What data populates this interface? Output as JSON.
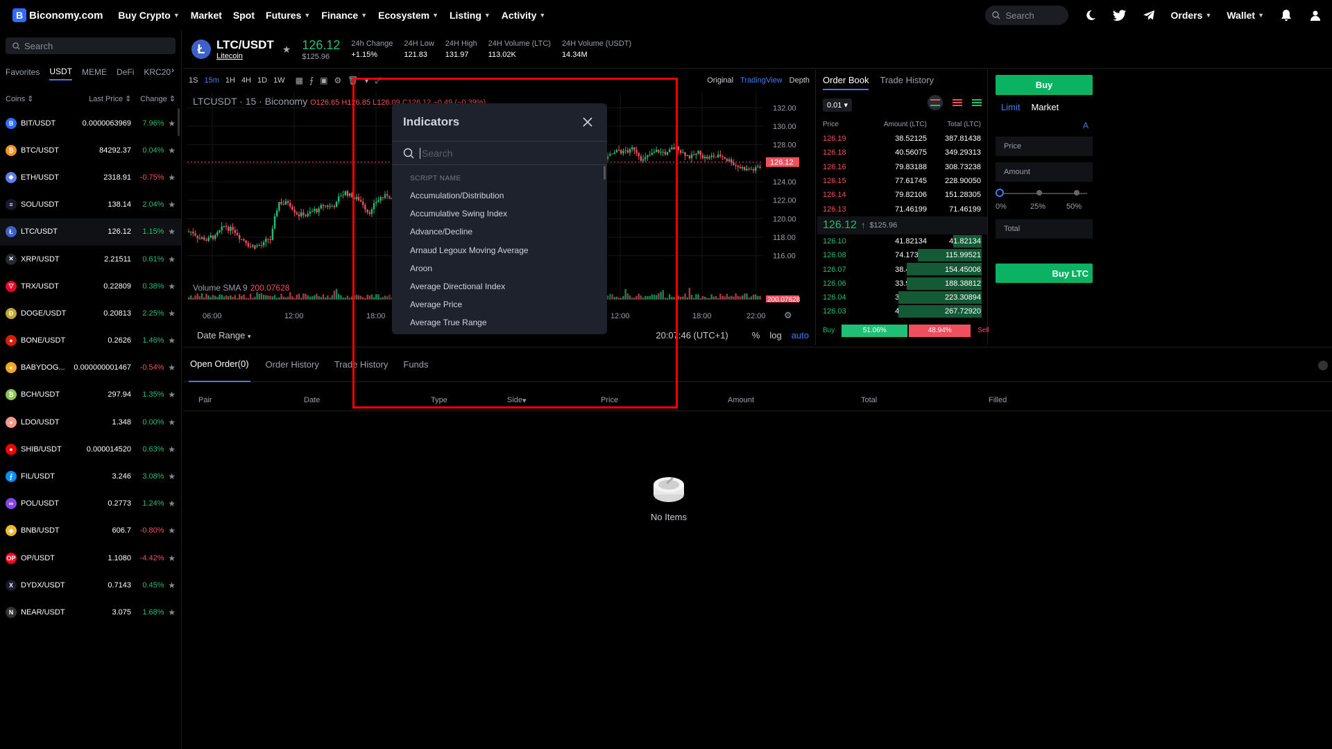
{
  "nav": {
    "logo_letter": "B",
    "logo_text": "Biconomy.com",
    "items": [
      {
        "label": "Buy Crypto",
        "caret": true
      },
      {
        "label": "Market",
        "caret": false
      },
      {
        "label": "Spot",
        "caret": false
      },
      {
        "label": "Futures",
        "caret": true
      },
      {
        "label": "Finance",
        "caret": true
      },
      {
        "label": "Ecosystem",
        "caret": true
      },
      {
        "label": "Listing",
        "caret": true
      },
      {
        "label": "Activity",
        "caret": true
      }
    ],
    "search_placeholder": "Search",
    "orders_label": "Orders",
    "wallet_label": "Wallet"
  },
  "sidebar": {
    "search_placeholder": "Search",
    "tabs": [
      "Favorites",
      "USDT",
      "MEME",
      "DeFi",
      "KRC20"
    ],
    "active_tab": "USDT",
    "headers": {
      "coins": "Coins",
      "price": "Last Price",
      "change": "Change"
    },
    "coins": [
      {
        "pair": "BIT/USDT",
        "price": "0.0000063969",
        "change": "7.96%",
        "dir": "pos",
        "color": "#2f6bff",
        "glyph": "B"
      },
      {
        "pair": "BTC/USDT",
        "price": "84292.37",
        "change": "0.04%",
        "dir": "pos",
        "color": "#f7931a",
        "glyph": "₿"
      },
      {
        "pair": "ETH/USDT",
        "price": "2318.91",
        "change": "-0.75%",
        "dir": "neg",
        "color": "#627eea",
        "glyph": "◆"
      },
      {
        "pair": "SOL/USDT",
        "price": "138.14",
        "change": "2.04%",
        "dir": "pos",
        "color": "#1a1a2e",
        "glyph": "≡"
      },
      {
        "pair": "LTC/USDT",
        "price": "126.12",
        "change": "1.15%",
        "dir": "pos",
        "color": "#3d61c9",
        "glyph": "Ł",
        "active": true
      },
      {
        "pair": "XRP/USDT",
        "price": "2.21511",
        "change": "0.61%",
        "dir": "pos",
        "color": "#23292f",
        "glyph": "✕"
      },
      {
        "pair": "TRX/USDT",
        "price": "0.22809",
        "change": "0.38%",
        "dir": "pos",
        "color": "#eb0029",
        "glyph": "▽"
      },
      {
        "pair": "DOGE/USDT",
        "price": "0.20813",
        "change": "2.25%",
        "dir": "pos",
        "color": "#c2a633",
        "glyph": "Ð"
      },
      {
        "pair": "BONE/USDT",
        "price": "0.2626",
        "change": "1.46%",
        "dir": "pos",
        "color": "#d81e06",
        "glyph": "●"
      },
      {
        "pair": "BABYDOG...",
        "price": "0.000000001467",
        "change": "-0.54%",
        "dir": "neg",
        "color": "#f5a623",
        "glyph": "●"
      },
      {
        "pair": "BCH/USDT",
        "price": "297.94",
        "change": "1.35%",
        "dir": "pos",
        "color": "#8dc351",
        "glyph": "₿"
      },
      {
        "pair": "LDO/USDT",
        "price": "1.348",
        "change": "0.00%",
        "dir": "pos",
        "color": "#f69988",
        "glyph": "●"
      },
      {
        "pair": "SHIB/USDT",
        "price": "0.000014520",
        "change": "0.63%",
        "dir": "pos",
        "color": "#f00500",
        "glyph": "●"
      },
      {
        "pair": "FIL/USDT",
        "price": "3.246",
        "change": "3.08%",
        "dir": "pos",
        "color": "#0090ff",
        "glyph": "⨍"
      },
      {
        "pair": "POL/USDT",
        "price": "0.2773",
        "change": "1.24%",
        "dir": "pos",
        "color": "#8247e5",
        "glyph": "∞"
      },
      {
        "pair": "BNB/USDT",
        "price": "606.7",
        "change": "-0.80%",
        "dir": "neg",
        "color": "#f3ba2f",
        "glyph": "◆"
      },
      {
        "pair": "OP/USDT",
        "price": "1.1080",
        "change": "-4.42%",
        "dir": "neg",
        "color": "#ff0420",
        "glyph": "OP"
      },
      {
        "pair": "DYDX/USDT",
        "price": "0.7143",
        "change": "0.45%",
        "dir": "pos",
        "color": "#1a1a2e",
        "glyph": "X"
      },
      {
        "pair": "NEAR/USDT",
        "price": "3.075",
        "change": "1.68%",
        "dir": "pos",
        "color": "#333",
        "glyph": "N"
      }
    ]
  },
  "ticker": {
    "logo_glyph": "Ł",
    "pair": "LTC/USDT",
    "name": "Litecoin",
    "price": "126.12",
    "sub_price": "$125.96",
    "stats": [
      {
        "label": "24h Change",
        "value": "+1.15%",
        "dir": "pos"
      },
      {
        "label": "24H Low",
        "value": "121.83"
      },
      {
        "label": "24H High",
        "value": "131.97"
      },
      {
        "label": "24H Volume (LTC)",
        "value": "113.02K"
      },
      {
        "label": "24H Volume (USDT)",
        "value": "14.34M"
      }
    ]
  },
  "chart_toolbar": {
    "timeframes": [
      "1S",
      "15m",
      "1H",
      "4H",
      "1D",
      "1W"
    ],
    "active_timeframe": "15m",
    "views": [
      "Original",
      "TradingView",
      "Depth"
    ],
    "active_view": "TradingView"
  },
  "chart": {
    "legend_symbol": "LTCUSDT · 15 · Biconomy",
    "legend_ohlc": "O126.65 H126.85 L126.09 C126.12 −0.49 (−0.39%)",
    "volume_label": "Volume SMA 9",
    "volume_value": "200.07628",
    "bottom_left": "Date Range",
    "time": "20:07:46 (UTC+1)",
    "bottom_right": [
      "%",
      "log",
      "auto"
    ],
    "last_price_tag": "126.12",
    "volume_tag": "200.07628"
  },
  "chart_data": {
    "type": "candlestick",
    "title": "LTCUSDT · 15 · Biconomy",
    "y_ticks": [
      "132.00",
      "130.00",
      "128.00",
      "126.00",
      "124.00",
      "122.00",
      "120.00",
      "118.00",
      "116.00"
    ],
    "x_ticks": [
      "06:00",
      "12:00",
      "18:00",
      "12:00",
      "18:00",
      "22:00"
    ],
    "ylim": [
      115,
      133
    ],
    "last_price": 126.12
  },
  "orderbook": {
    "tabs": [
      "Order Book",
      "Trade History"
    ],
    "active_tab": "Order Book",
    "precision": "0.01",
    "headers": [
      "Price",
      "Amount (LTC)",
      "Total (LTC)"
    ],
    "asks": [
      {
        "price": "126.19",
        "amount": "38.52125",
        "total": "387.81438"
      },
      {
        "price": "126.18",
        "amount": "40.56075",
        "total": "349.29313"
      },
      {
        "price": "126.16",
        "amount": "79.83188",
        "total": "308.73238"
      },
      {
        "price": "126.15",
        "amount": "77.61745",
        "total": "228.90050"
      },
      {
        "price": "126.14",
        "amount": "79.82106",
        "total": "151.28305"
      },
      {
        "price": "126.13",
        "amount": "71.46199",
        "total": "71.46199"
      }
    ],
    "mid_price": "126.12",
    "mid_sub": "$125.96",
    "bids": [
      {
        "price": "126.10",
        "amount": "41.82134",
        "total": "41.82134",
        "depth": 0.18
      },
      {
        "price": "126.08",
        "amount": "74.17388",
        "total": "115.99521",
        "depth": 0.4
      },
      {
        "price": "126.07",
        "amount": "38.45485",
        "total": "154.45006",
        "depth": 0.47
      },
      {
        "price": "126.06",
        "amount": "33.93805",
        "total": "188.38812",
        "depth": 0.47
      },
      {
        "price": "126.04",
        "amount": "34.92083",
        "total": "223.30894",
        "depth": 0.52
      },
      {
        "price": "126.03",
        "amount": "44.42025",
        "total": "267.72920",
        "depth": 0.52
      }
    ],
    "buy_label": "Buy",
    "buy_pct": "51.06%",
    "sell_pct": "48.94%",
    "sell_label": "Sell",
    "buy_ratio": 0.5106
  },
  "tradeform": {
    "buy_tab": "Buy",
    "types": [
      "Limit",
      "Market"
    ],
    "active_type": "Limit",
    "extra": "A",
    "price_placeholder": "Price",
    "amount_placeholder": "Amount",
    "total_placeholder": "Total",
    "pcts": [
      "0%",
      "25%",
      "50%"
    ],
    "submit": "Buy LTC"
  },
  "orders": {
    "tabs": [
      "Open Order(0)",
      "Order History",
      "Trade History",
      "Funds"
    ],
    "active_tab": "Open Order(0)",
    "columns": [
      "Pair",
      "Date",
      "Type",
      "Side",
      "Price",
      "Amount",
      "Total",
      "Filled"
    ],
    "empty_text": "No Items"
  },
  "indicators": {
    "title": "Indicators",
    "search_placeholder": "Search",
    "section_label": "SCRIPT NAME",
    "items": [
      "Accumulation/Distribution",
      "Accumulative Swing Index",
      "Advance/Decline",
      "Arnaud Legoux Moving Average",
      "Aroon",
      "Average Directional Index",
      "Average Price",
      "Average True Range"
    ]
  },
  "colors": {
    "up": "#1fbf75",
    "down": "#f0505d",
    "accent": "#3d7cf5",
    "highlight": "#ff0000"
  }
}
